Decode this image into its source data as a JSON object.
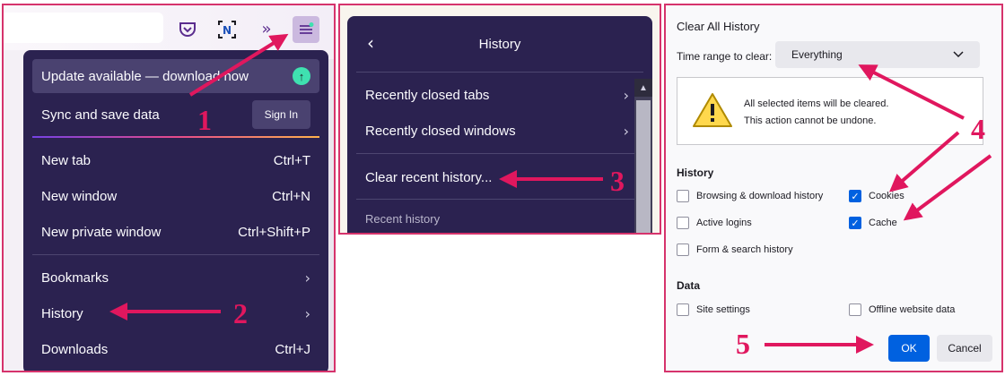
{
  "toolbar": {
    "icons": [
      "pocket-icon",
      "screenshot-icon",
      "overflow-chevrons-icon",
      "hamburger-menu-icon"
    ]
  },
  "app_menu": {
    "update": "Update available — download now",
    "sync": "Sync and save data",
    "sign_in": "Sign In",
    "items": [
      {
        "label": "New tab",
        "shortcut": "Ctrl+T"
      },
      {
        "label": "New window",
        "shortcut": "Ctrl+N"
      },
      {
        "label": "New private window",
        "shortcut": "Ctrl+Shift+P"
      }
    ],
    "bookmarks": "Bookmarks",
    "history": "History",
    "downloads": "Downloads",
    "downloads_shortcut": "Ctrl+J"
  },
  "history_menu": {
    "title": "History",
    "recently_closed_tabs": "Recently closed tabs",
    "recently_closed_windows": "Recently closed windows",
    "clear_recent": "Clear recent history...",
    "recent_history": "Recent history"
  },
  "dialog": {
    "title": "Clear All History",
    "time_range_label": "Time range to clear:",
    "time_range_value": "Everything",
    "warning_line1": "All selected items will be cleared.",
    "warning_line2": "This action cannot be undone.",
    "history_heading": "History",
    "options": {
      "browsing": "Browsing & download history",
      "cookies": "Cookies",
      "active_logins": "Active logins",
      "cache": "Cache",
      "form_search": "Form & search history"
    },
    "data_heading": "Data",
    "site_settings": "Site settings",
    "offline_data": "Offline website data",
    "ok": "OK",
    "cancel": "Cancel"
  },
  "annotations": {
    "step1": "1",
    "step2": "2",
    "step3": "3",
    "step4": "4",
    "step5": "5",
    "color": "#e0175e"
  },
  "colors": {
    "menu_bg": "#2b2250",
    "accent_blue": "#0061e0",
    "frame": "#d6336c"
  }
}
